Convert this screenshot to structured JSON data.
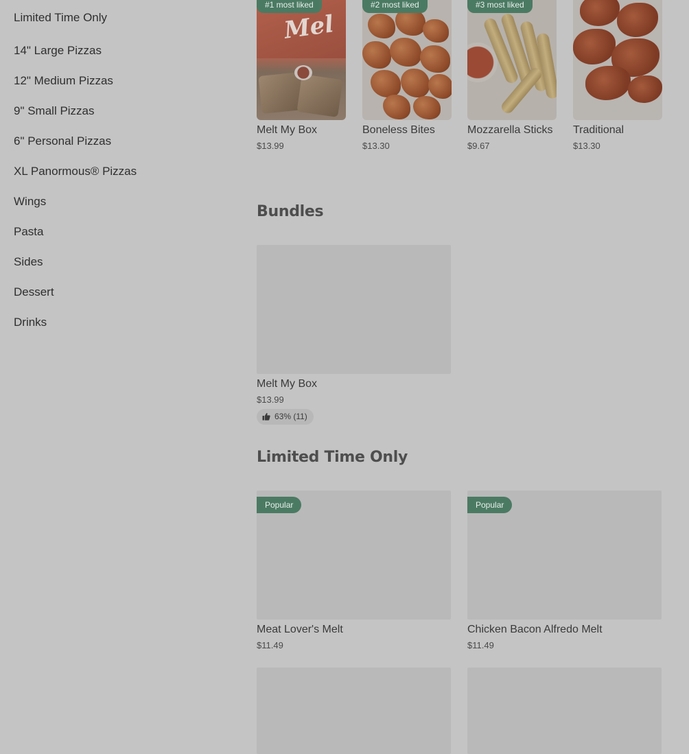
{
  "sidebar": {
    "items": [
      {
        "label": "Limited Time Only"
      },
      {
        "label": "14\" Large Pizzas"
      },
      {
        "label": "12\" Medium Pizzas"
      },
      {
        "label": "9\" Small Pizzas"
      },
      {
        "label": "6\" Personal Pizzas"
      },
      {
        "label": "XL Panormous® Pizzas"
      },
      {
        "label": "Wings"
      },
      {
        "label": "Pasta"
      },
      {
        "label": "Sides"
      },
      {
        "label": "Dessert"
      },
      {
        "label": "Drinks"
      }
    ]
  },
  "most_liked": {
    "items": [
      {
        "badge": "#1 most liked",
        "name": "Melt My Box",
        "price": "$13.99"
      },
      {
        "badge": "#2 most liked",
        "name": "Boneless Bites",
        "price": "$13.30"
      },
      {
        "badge": "#3 most liked",
        "name": "Mozzarella Sticks",
        "price": "$9.67"
      },
      {
        "name": "Traditional",
        "price": "$13.30"
      }
    ]
  },
  "bundles": {
    "title": "Bundles",
    "items": [
      {
        "name": "Melt My Box",
        "price": "$13.99",
        "rating": "63% (11)"
      }
    ]
  },
  "limited": {
    "title": "Limited Time Only",
    "items": [
      {
        "badge": "Popular",
        "name": "Meat Lover's Melt",
        "price": "$11.49"
      },
      {
        "badge": "Popular",
        "name": "Chicken Bacon Alfredo Melt",
        "price": "$11.49"
      }
    ]
  },
  "colors": {
    "overlay_background": "#c4c4c4",
    "badge_green": "#4b7a63"
  },
  "icons": {
    "rating": "thumbs-up-icon"
  }
}
